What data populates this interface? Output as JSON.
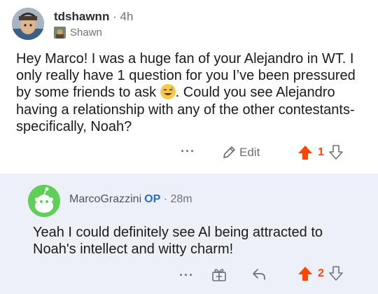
{
  "top_comment": {
    "username": "tdshawnn",
    "separator": "·",
    "time": "4h",
    "flair": "Shawn",
    "body_part1": "Hey Marco! I was a huge fan of your Alejandro in WT. I only really have 1 question for you I’ve been pressured by some friends to ask ",
    "body_part2": ". Could you see Alejandro having a relationship with any of the other contestants- specifically, Noah?",
    "more_label": "···",
    "edit_label": "Edit",
    "upvotes": "1"
  },
  "reply": {
    "username": "MarcoGrazzini",
    "op_badge": "OP",
    "separator": "·",
    "time": "28m",
    "body": "Yeah I could definitely see Al being attracted to Noah's intellect and witty charm!",
    "more_label": "···",
    "upvotes": "2"
  },
  "colors": {
    "upvote": "#ff4500",
    "op": "#1e6fd9",
    "reply_bg": "#eef0f7"
  }
}
